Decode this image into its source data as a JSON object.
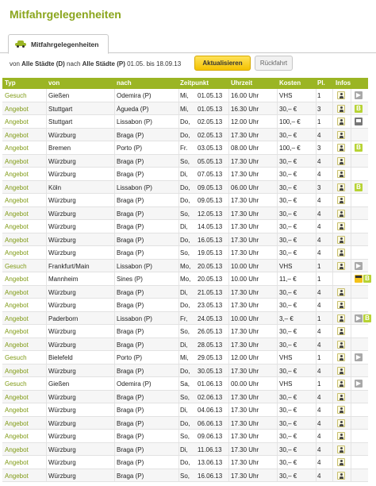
{
  "page": {
    "title": "Mitfahrgelegenheiten"
  },
  "tab": {
    "label": "Mitfahrgelegenheiten",
    "icon": "car-icon"
  },
  "filter": {
    "prefix": "von",
    "from": "Alle Städte (D)",
    "middle": "nach",
    "to": "Alle Städte (P)",
    "dates": "01.05. bis 18.09.13",
    "update_label": "Aktualisieren",
    "back_label": "Rückfahrt"
  },
  "table": {
    "headers": [
      "Typ",
      "von",
      "nach",
      "Zeitpunkt",
      "Uhrzeit",
      "Kosten",
      "Pl.",
      "Infos"
    ],
    "rows": [
      {
        "typ": "Gesuch",
        "von": "Gießen",
        "nach": "Odemira (P)",
        "tag": "Mi,",
        "datum": "01.05.13",
        "uhrzeit": "16.00 Uhr",
        "kosten": "VHS",
        "pl": "1",
        "icons": [
          "person",
          "arrow"
        ]
      },
      {
        "typ": "Angebot",
        "von": "Stuttgart",
        "nach": "Águeda (P)",
        "tag": "Mi,",
        "datum": "01.05.13",
        "uhrzeit": "16.30 Uhr",
        "kosten": "30,– €",
        "pl": "3",
        "icons": [
          "person",
          "b"
        ]
      },
      {
        "typ": "Angebot",
        "von": "Stuttgart",
        "nach": "Lissabon (P)",
        "tag": "Do,",
        "datum": "02.05.13",
        "uhrzeit": "12.00 Uhr",
        "kosten": "100,– €",
        "pl": "1",
        "icons": [
          "person",
          "bus"
        ]
      },
      {
        "typ": "Angebot",
        "von": "Würzburg",
        "nach": "Braga (P)",
        "tag": "Do,",
        "datum": "02.05.13",
        "uhrzeit": "17.30 Uhr",
        "kosten": "30,– €",
        "pl": "4",
        "icons": [
          "person"
        ]
      },
      {
        "typ": "Angebot",
        "von": "Bremen",
        "nach": "Porto (P)",
        "tag": "Fr.",
        "datum": "03.05.13",
        "uhrzeit": "08.00 Uhr",
        "kosten": "100,– €",
        "pl": "3",
        "icons": [
          "person",
          "b"
        ]
      },
      {
        "typ": "Angebot",
        "von": "Würzburg",
        "nach": "Braga (P)",
        "tag": "So,",
        "datum": "05.05.13",
        "uhrzeit": "17.30 Uhr",
        "kosten": "30,– €",
        "pl": "4",
        "icons": [
          "person"
        ]
      },
      {
        "typ": "Angebot",
        "von": "Würzburg",
        "nach": "Braga (P)",
        "tag": "Di,",
        "datum": "07.05.13",
        "uhrzeit": "17.30 Uhr",
        "kosten": "30,– €",
        "pl": "4",
        "icons": [
          "person"
        ]
      },
      {
        "typ": "Angebot",
        "von": "Köln",
        "nach": "Lissabon (P)",
        "tag": "Do,",
        "datum": "09.05.13",
        "uhrzeit": "06.00 Uhr",
        "kosten": "30,– €",
        "pl": "3",
        "icons": [
          "person",
          "b"
        ]
      },
      {
        "typ": "Angebot",
        "von": "Würzburg",
        "nach": "Braga (P)",
        "tag": "Do,",
        "datum": "09.05.13",
        "uhrzeit": "17.30 Uhr",
        "kosten": "30,– €",
        "pl": "4",
        "icons": [
          "person"
        ]
      },
      {
        "typ": "Angebot",
        "von": "Würzburg",
        "nach": "Braga (P)",
        "tag": "So,",
        "datum": "12.05.13",
        "uhrzeit": "17.30 Uhr",
        "kosten": "30,– €",
        "pl": "4",
        "icons": [
          "person"
        ]
      },
      {
        "typ": "Angebot",
        "von": "Würzburg",
        "nach": "Braga (P)",
        "tag": "Di,",
        "datum": "14.05.13",
        "uhrzeit": "17.30 Uhr",
        "kosten": "30,– €",
        "pl": "4",
        "icons": [
          "person"
        ]
      },
      {
        "typ": "Angebot",
        "von": "Würzburg",
        "nach": "Braga (P)",
        "tag": "Do,",
        "datum": "16.05.13",
        "uhrzeit": "17.30 Uhr",
        "kosten": "30,– €",
        "pl": "4",
        "icons": [
          "person"
        ]
      },
      {
        "typ": "Angebot",
        "von": "Würzburg",
        "nach": "Braga (P)",
        "tag": "So,",
        "datum": "19.05.13",
        "uhrzeit": "17.30 Uhr",
        "kosten": "30,– €",
        "pl": "4",
        "icons": [
          "person"
        ]
      },
      {
        "typ": "Gesuch",
        "von": "Frankfurt/Main",
        "nach": "Lissabon (P)",
        "tag": "Mo,",
        "datum": "20.05.13",
        "uhrzeit": "10.00 Uhr",
        "kosten": "VHS",
        "pl": "1",
        "icons": [
          "person",
          "arrow"
        ]
      },
      {
        "typ": "Angebot",
        "von": "Mannheim",
        "nach": "Sines (P)",
        "tag": "Mo,",
        "datum": "20.05.13",
        "uhrzeit": "10.00 Uhr",
        "kosten": "11,– €",
        "pl": "1",
        "icons": [
          "ticket",
          "b"
        ]
      },
      {
        "typ": "Angebot",
        "von": "Würzburg",
        "nach": "Braga (P)",
        "tag": "Di,",
        "datum": "21.05.13",
        "uhrzeit": "17.30 Uhr",
        "kosten": "30,– €",
        "pl": "4",
        "icons": [
          "person"
        ]
      },
      {
        "typ": "Angebot",
        "von": "Würzburg",
        "nach": "Braga (P)",
        "tag": "Do,",
        "datum": "23.05.13",
        "uhrzeit": "17.30 Uhr",
        "kosten": "30,– €",
        "pl": "4",
        "icons": [
          "person"
        ]
      },
      {
        "typ": "Angebot",
        "von": "Paderborn",
        "nach": "Lissabon (P)",
        "tag": "Fr,",
        "datum": "24.05.13",
        "uhrzeit": "10.00 Uhr",
        "kosten": "3,– €",
        "pl": "1",
        "icons": [
          "person",
          "arrow",
          "b"
        ]
      },
      {
        "typ": "Angebot",
        "von": "Würzburg",
        "nach": "Braga (P)",
        "tag": "So,",
        "datum": "26.05.13",
        "uhrzeit": "17.30 Uhr",
        "kosten": "30,– €",
        "pl": "4",
        "icons": [
          "person"
        ]
      },
      {
        "typ": "Angebot",
        "von": "Würzburg",
        "nach": "Braga (P)",
        "tag": "Di,",
        "datum": "28.05.13",
        "uhrzeit": "17.30 Uhr",
        "kosten": "30,– €",
        "pl": "4",
        "icons": [
          "person"
        ]
      },
      {
        "typ": "Gesuch",
        "von": "Bielefeld",
        "nach": "Porto (P)",
        "tag": "Mi,",
        "datum": "29.05.13",
        "uhrzeit": "12.00 Uhr",
        "kosten": "VHS",
        "pl": "1",
        "icons": [
          "person",
          "arrow"
        ]
      },
      {
        "typ": "Angebot",
        "von": "Würzburg",
        "nach": "Braga (P)",
        "tag": "Do,",
        "datum": "30.05.13",
        "uhrzeit": "17.30 Uhr",
        "kosten": "30,– €",
        "pl": "4",
        "icons": [
          "person"
        ]
      },
      {
        "typ": "Gesuch",
        "von": "Gießen",
        "nach": "Odemira (P)",
        "tag": "Sa,",
        "datum": "01.06.13",
        "uhrzeit": "00.00 Uhr",
        "kosten": "VHS",
        "pl": "1",
        "icons": [
          "person",
          "arrow"
        ]
      },
      {
        "typ": "Angebot",
        "von": "Würzburg",
        "nach": "Braga (P)",
        "tag": "So,",
        "datum": "02.06.13",
        "uhrzeit": "17.30 Uhr",
        "kosten": "30,– €",
        "pl": "4",
        "icons": [
          "person"
        ]
      },
      {
        "typ": "Angebot",
        "von": "Würzburg",
        "nach": "Braga (P)",
        "tag": "Di,",
        "datum": "04.06.13",
        "uhrzeit": "17.30 Uhr",
        "kosten": "30,– €",
        "pl": "4",
        "icons": [
          "person"
        ]
      },
      {
        "typ": "Angebot",
        "von": "Würzburg",
        "nach": "Braga (P)",
        "tag": "Do,",
        "datum": "06.06.13",
        "uhrzeit": "17.30 Uhr",
        "kosten": "30,– €",
        "pl": "4",
        "icons": [
          "person"
        ]
      },
      {
        "typ": "Angebot",
        "von": "Würzburg",
        "nach": "Braga (P)",
        "tag": "So,",
        "datum": "09.06.13",
        "uhrzeit": "17.30 Uhr",
        "kosten": "30,– €",
        "pl": "4",
        "icons": [
          "person"
        ]
      },
      {
        "typ": "Angebot",
        "von": "Würzburg",
        "nach": "Braga (P)",
        "tag": "Di,",
        "datum": "11.06.13",
        "uhrzeit": "17.30 Uhr",
        "kosten": "30,– €",
        "pl": "4",
        "icons": [
          "person"
        ]
      },
      {
        "typ": "Angebot",
        "von": "Würzburg",
        "nach": "Braga (P)",
        "tag": "Do,",
        "datum": "13.06.13",
        "uhrzeit": "17.30 Uhr",
        "kosten": "30,– €",
        "pl": "4",
        "icons": [
          "person"
        ]
      },
      {
        "typ": "Angebot",
        "von": "Würzburg",
        "nach": "Braga (P)",
        "tag": "So,",
        "datum": "16.06.13",
        "uhrzeit": "17.30 Uhr",
        "kosten": "30,– €",
        "pl": "4",
        "icons": [
          "person"
        ]
      }
    ]
  },
  "colors": {
    "accent": "#9bb524",
    "title": "#8aa51c",
    "button": "#f3c100"
  }
}
